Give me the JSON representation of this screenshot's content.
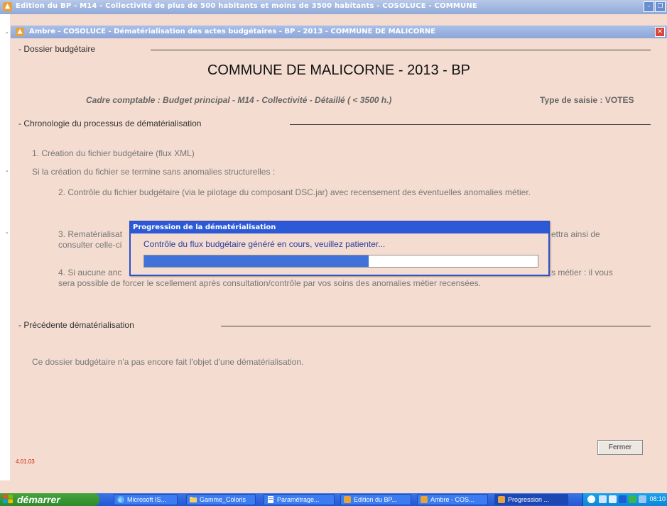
{
  "outer_window": {
    "title": "Edition du BP - M14 - Collectivité de plus de 500 habitants et moins de 3500 habitants - COSOLUCE - COMMUNE"
  },
  "inner_window": {
    "title": "Ambre - COSOLUCE - Dématérialisation des actes budgétaires - BP - 2013 - COMMUNE DE MALICORNE"
  },
  "main": {
    "section_dossier": "- Dossier budgétaire",
    "page_title": "COMMUNE DE MALICORNE - 2013 - BP",
    "cadre": "Cadre comptable : Budget principal - M14 - Collectivité - Détaillé ( < 3500 h.)",
    "type_saisie": "Type de saisie : VOTES",
    "section_chronologie": "- Chronologie du processus de dématérialisation",
    "step1": "1. Création du fichier budgétaire (flux XML)",
    "condition": "Si la création du fichier se termine sans anomalies structurelles :",
    "step2": "2. Contrôle du fichier budgétaire (via le pilotage du composant DSC.jar) avec recensement des éventuelles anomalies métier.",
    "step3_line1_left": "3. Rematérialisat",
    "step3_line1_right": "ettra ainsi de",
    "step3_line2_left": "consulter celle-ci",
    "step4_line1_left": "4. Si aucune anc",
    "step4_line1_right": "s métier : il vous",
    "step4_line2": "sera possible de forcer le scellement après consultation/contrôle par vos soins des anomalies métier recensées.",
    "section_precedente": "- Précédente dématérialisation",
    "no_demat": "Ce dossier budgétaire n'a pas encore fait l'objet d'une dématérialisation.",
    "version": "4.01.03",
    "close_button": "Fermer"
  },
  "dialog": {
    "title": "Progression de la dématérialisation",
    "message": "Contrôle du flux budgétaire généré en cours, veuillez patienter...",
    "progress": 0.57
  },
  "taskbar": {
    "start_label": "démarrer",
    "items": [
      {
        "label": "Microsoft IS...",
        "icon": "ie-icon"
      },
      {
        "label": "Gamme_Coloris",
        "icon": "folder-icon"
      },
      {
        "label": "Paramétrage...",
        "icon": "document-icon"
      },
      {
        "label": "Edition du BP...",
        "icon": "app-icon"
      },
      {
        "label": "Ambre - COS...",
        "icon": "app-icon"
      },
      {
        "label": "Progression ...",
        "icon": "app-icon"
      }
    ],
    "clock": "08:10"
  },
  "colors": {
    "background": "#f4dcd0",
    "titlebar_blue": "#2c5ad6",
    "progress_fill": "#4172d9",
    "message_text": "#2a3fa0"
  }
}
